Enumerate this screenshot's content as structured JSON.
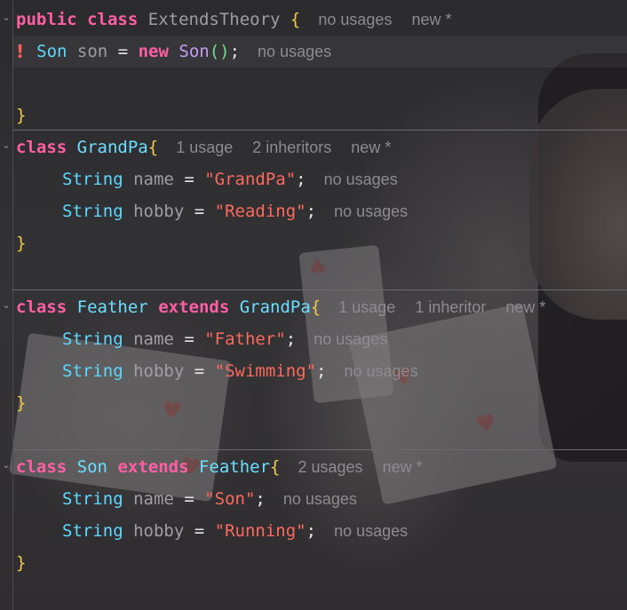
{
  "theme": {
    "keyword": "#fc5fa3",
    "type": "#5dd8ff",
    "string": "#fc6a5d",
    "variable": "#9f9fa3",
    "brace": "#f2c94c",
    "error": "#ff5a5a",
    "hint": "#8c8c90"
  },
  "icons": {
    "error": "error-icon",
    "fold": "chevron-down-icon"
  },
  "blocks": {
    "theory": {
      "kw1": "public",
      "kw2": "class",
      "name": "ExtendsTheory",
      "open": "{",
      "hints": [
        "no usages",
        "new *"
      ],
      "field": {
        "error_glyph": "!",
        "type": "Son",
        "var": "son",
        "eq": "=",
        "kw": "new",
        "ctor": "Son",
        "parens": "()",
        "semi": ";",
        "hint": "no usages"
      },
      "close": "}"
    },
    "grandpa": {
      "kw": "class",
      "name": "GrandPa",
      "open": "{",
      "hints": [
        "1 usage",
        "2 inheritors",
        "new *"
      ],
      "fields": [
        {
          "type": "String",
          "var": "name",
          "eq": "=",
          "value": "\"GrandPa\"",
          "semi": ";",
          "hint": "no usages"
        },
        {
          "type": "String",
          "var": "hobby",
          "eq": "=",
          "value": "\"Reading\"",
          "semi": ";",
          "hint": "no usages"
        }
      ],
      "close": "}"
    },
    "feather": {
      "kw": "class",
      "name": "Feather",
      "extends_kw": "extends",
      "parent": "GrandPa",
      "open": "{",
      "hints": [
        "1 usage",
        "1 inheritor",
        "new *"
      ],
      "fields": [
        {
          "type": "String",
          "var": "name",
          "eq": "=",
          "value": "\"Father\"",
          "semi": ";",
          "hint": "no usages"
        },
        {
          "type": "String",
          "var": "hobby",
          "eq": "=",
          "value": "\"Swimming\"",
          "semi": ";",
          "hint": "no usages"
        }
      ],
      "close": "}"
    },
    "son": {
      "kw": "class",
      "name": "Son",
      "extends_kw": "extends",
      "parent": "Feather",
      "open": "{",
      "hints": [
        "2 usages",
        "new *"
      ],
      "fields": [
        {
          "type": "String",
          "var": "name",
          "eq": "=",
          "value": "\"Son\"",
          "semi": ";",
          "hint": "no usages"
        },
        {
          "type": "String",
          "var": "hobby",
          "eq": "=",
          "value": "\"Running\"",
          "semi": ";",
          "hint": "no usages"
        }
      ],
      "close": "}"
    }
  }
}
